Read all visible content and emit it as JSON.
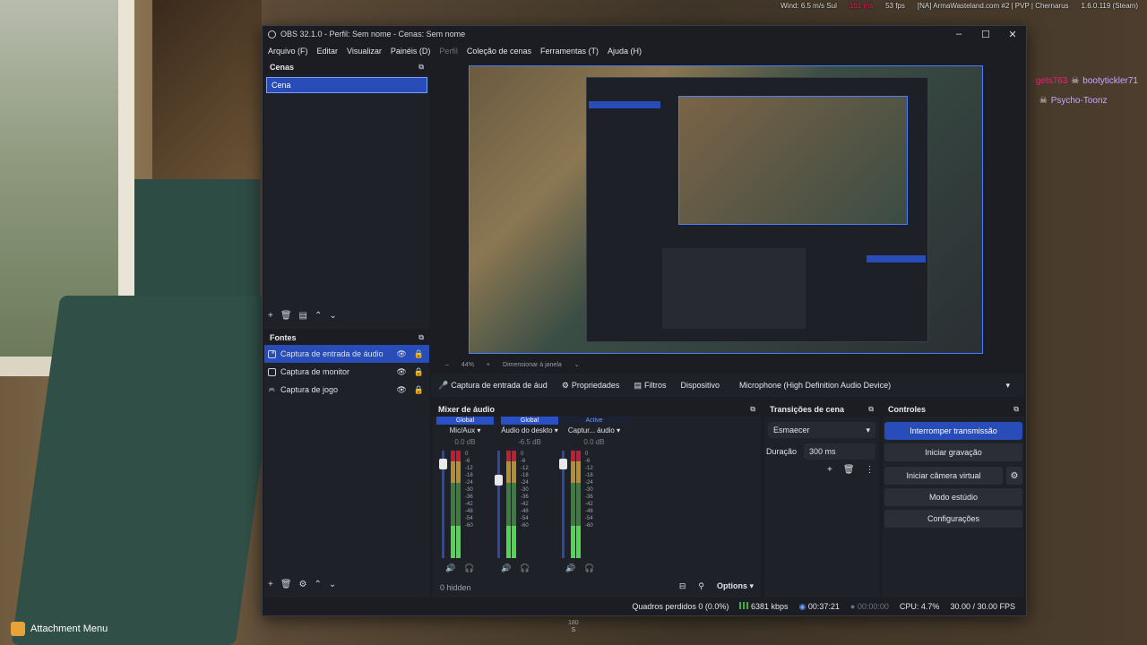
{
  "overlay": {
    "wind": "Wind: 6.5 m/s Sul",
    "dist": "161 ms",
    "fps": "53 fps",
    "server": "[NA] ArmaWasteland.com #2 | PVP | Chernarus",
    "version": "1.6.0.119 (Steam)",
    "chat": [
      {
        "user": "gets763",
        "other": "bootytickler71"
      },
      {
        "user": "",
        "other": "Psycho-Toonz"
      }
    ],
    "hint": "Attachment Menu",
    "ruler_top": "180",
    "ruler_bot": "S"
  },
  "window": {
    "title": "OBS 32.1.0 - Perfil: Sem nome - Cenas: Sem nome",
    "menu": [
      "Arquivo (F)",
      "Editar",
      "Visualizar",
      "Painéis (D)",
      "Perfil",
      "Coleção de cenas",
      "Ferramentas (T)",
      "Ajuda (H)"
    ]
  },
  "scenes": {
    "title": "Cenas",
    "items": [
      "Cena"
    ]
  },
  "sources": {
    "title": "Fontes",
    "items": [
      "Captura de entrada de áudio",
      "Captura de monitor",
      "Captura de jogo"
    ]
  },
  "preview": {
    "zoom": "44%",
    "resize": "Dimensionar à janela"
  },
  "context": {
    "source": "Captura de entrada de áud",
    "props": "Propriedades",
    "filters": "Filtros",
    "device_label": "Dispositivo",
    "device": "Microphone (High Definition Audio Device)"
  },
  "mixer": {
    "title": "Mixer de áudio",
    "channels": [
      {
        "tag": "Global",
        "name": "Mic/Aux",
        "db": "0.0 dB",
        "level": 0.92
      },
      {
        "tag": "Global",
        "name": "Áudio do deskto",
        "db": "-6.5 dB",
        "level": 0.75
      },
      {
        "tag": "Active",
        "name": "Captur... áudio",
        "db": "0.0 dB",
        "level": 0.92
      }
    ],
    "scale": [
      "0",
      "-6",
      "-12",
      "-18",
      "-24",
      "-30",
      "-36",
      "-42",
      "-48",
      "-54",
      "-60"
    ],
    "hidden": "0 hidden",
    "options": "Options"
  },
  "transitions": {
    "title": "Transições de cena",
    "selected": "Esmaecer",
    "duration_label": "Duração",
    "duration": "300 ms"
  },
  "controls": {
    "title": "Controles",
    "stop_stream": "Interromper transmissão",
    "record": "Iniciar gravação",
    "virtual_cam": "Iniciar câmera virtual",
    "studio": "Modo estúdio",
    "settings": "Configurações"
  },
  "status": {
    "dropped": "Quadros perdidos 0 (0.0%)",
    "bitrate": "6381 kbps",
    "live_time": "00:37:21",
    "rec_time": "00:00:00",
    "cpu": "CPU: 4.7%",
    "fps": "30.00 / 30.00 FPS"
  }
}
